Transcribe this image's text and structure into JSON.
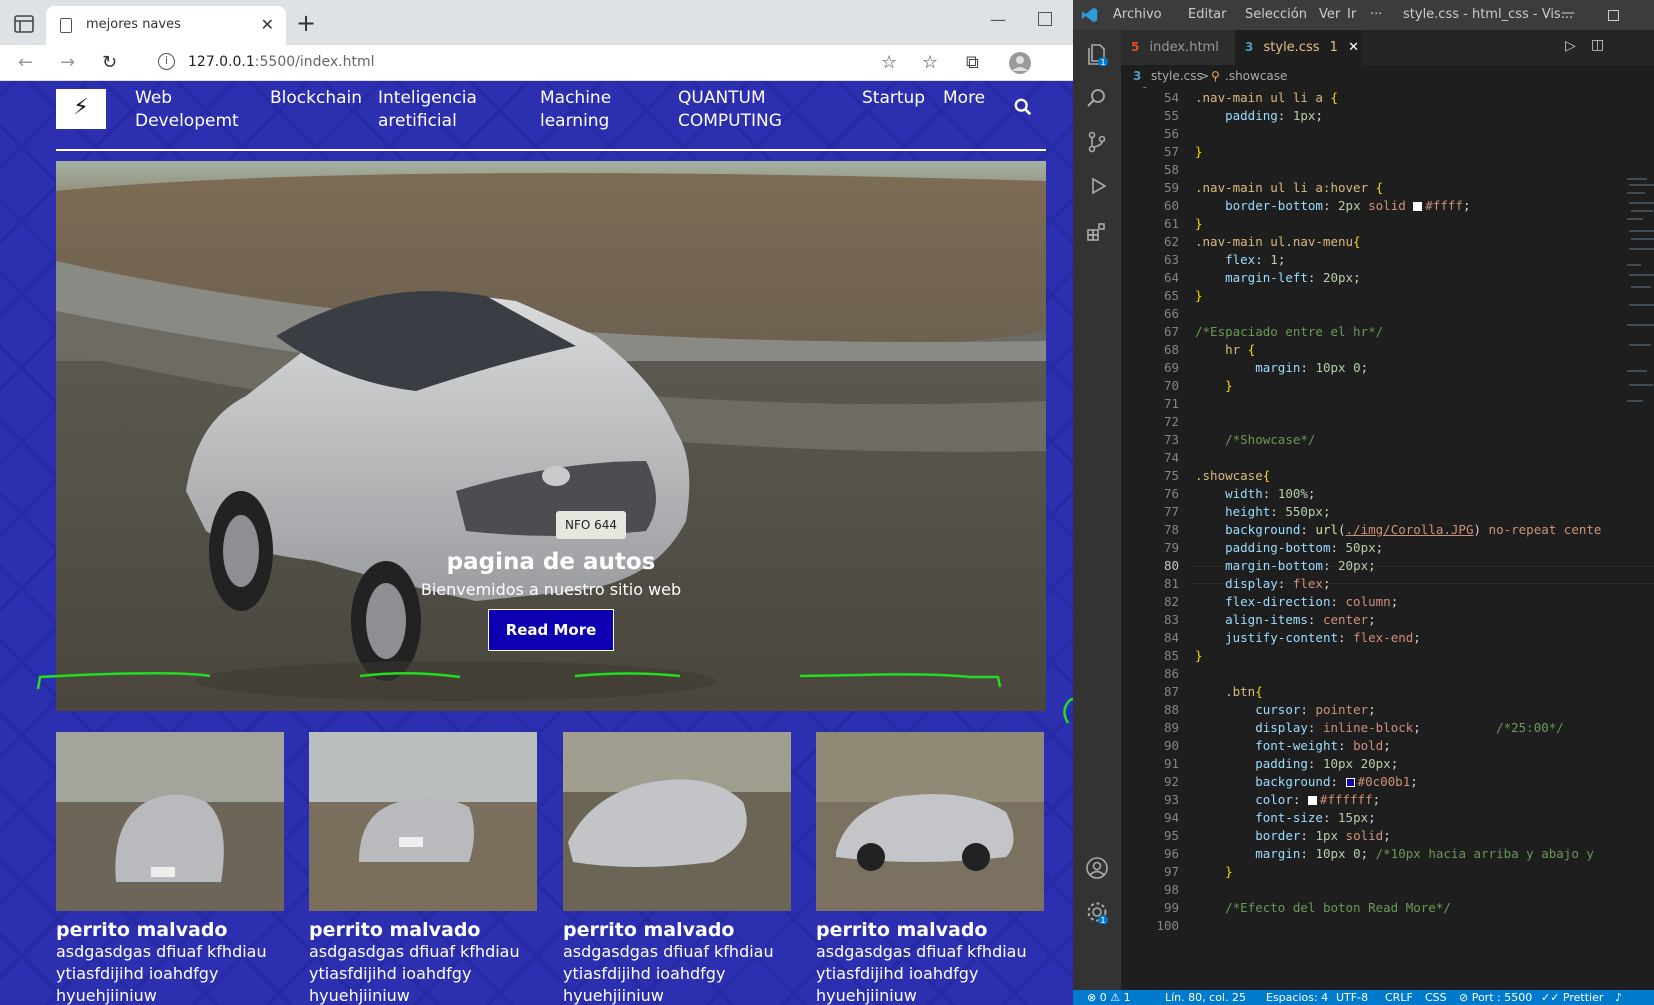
{
  "browser": {
    "tab_title": "mejores naves",
    "url_host": "127.0.0.1",
    "url_rest": ":5500/index.html",
    "new_tab": "+",
    "close": "✕"
  },
  "site": {
    "nav": [
      {
        "label_l1": "Web",
        "label_l2": "Developemt"
      },
      {
        "label_l1": "Blockchain",
        "label_l2": ""
      },
      {
        "label_l1": "Inteligencia",
        "label_l2": "aretificial"
      },
      {
        "label_l1": "Machine",
        "label_l2": "learning"
      },
      {
        "label_l1": "QUANTUM",
        "label_l2": "COMPUTING"
      },
      {
        "label_l1": "Startup",
        "label_l2": ""
      },
      {
        "label_l1": "More",
        "label_l2": ""
      }
    ],
    "logo_glyph": "⚡",
    "showcase": {
      "title": "pagina de autos",
      "subtitle": "Bienvemidos a nuestro sitio web",
      "button": "Read More",
      "plate": "NFO 644"
    },
    "cards": [
      {
        "title": "perrito malvado",
        "line1": "asdgasdgas dfiuaf kfhdiau",
        "line2": "ytiasfdijihd ioahdfgy",
        "line3": "hyuehjiiniuw"
      },
      {
        "title": "perrito malvado",
        "line1": "asdgasdgas dfiuaf kfhdiau",
        "line2": "ytiasfdijihd ioahdfgy",
        "line3": "hyuehjiiniuw"
      },
      {
        "title": "perrito malvado",
        "line1": "asdgasdgas dfiuaf kfhdiau",
        "line2": "ytiasfdijihd ioahdfgy",
        "line3": "hyuehjiiniuw"
      },
      {
        "title": "perrito malvado",
        "line1": "asdgasdgas dfiuaf kfhdiau",
        "line2": "ytiasfdijihd ioahdfgy",
        "line3": "hyuehjiiniuw"
      }
    ],
    "colors": {
      "bg": "#2b2fb0",
      "button": "#0c00b1",
      "annotation": "#22dd22"
    }
  },
  "vscode": {
    "menu": [
      "Archivo",
      "Editar",
      "Selección",
      "Ver",
      "Ir",
      "···"
    ],
    "window_title": "style.css - html_css - Vis...",
    "tabs": [
      {
        "label": "index.html",
        "mark": "●"
      },
      {
        "label": "style.css",
        "mark": "1"
      }
    ],
    "breadcrumb": {
      "file": "style.css",
      "sep": ">",
      "symbol": ".showcase"
    },
    "status": {
      "problems": "⊗ 0 ⚠ 1",
      "position": "Lín. 80, col. 25",
      "spaces": "Espacios: 4",
      "encoding": "UTF-8",
      "eol": "CRLF",
      "lang": "CSS",
      "port": "⊘ Port : 5500",
      "prettier": "✓✓ Prettier"
    },
    "current_line": 80
  }
}
